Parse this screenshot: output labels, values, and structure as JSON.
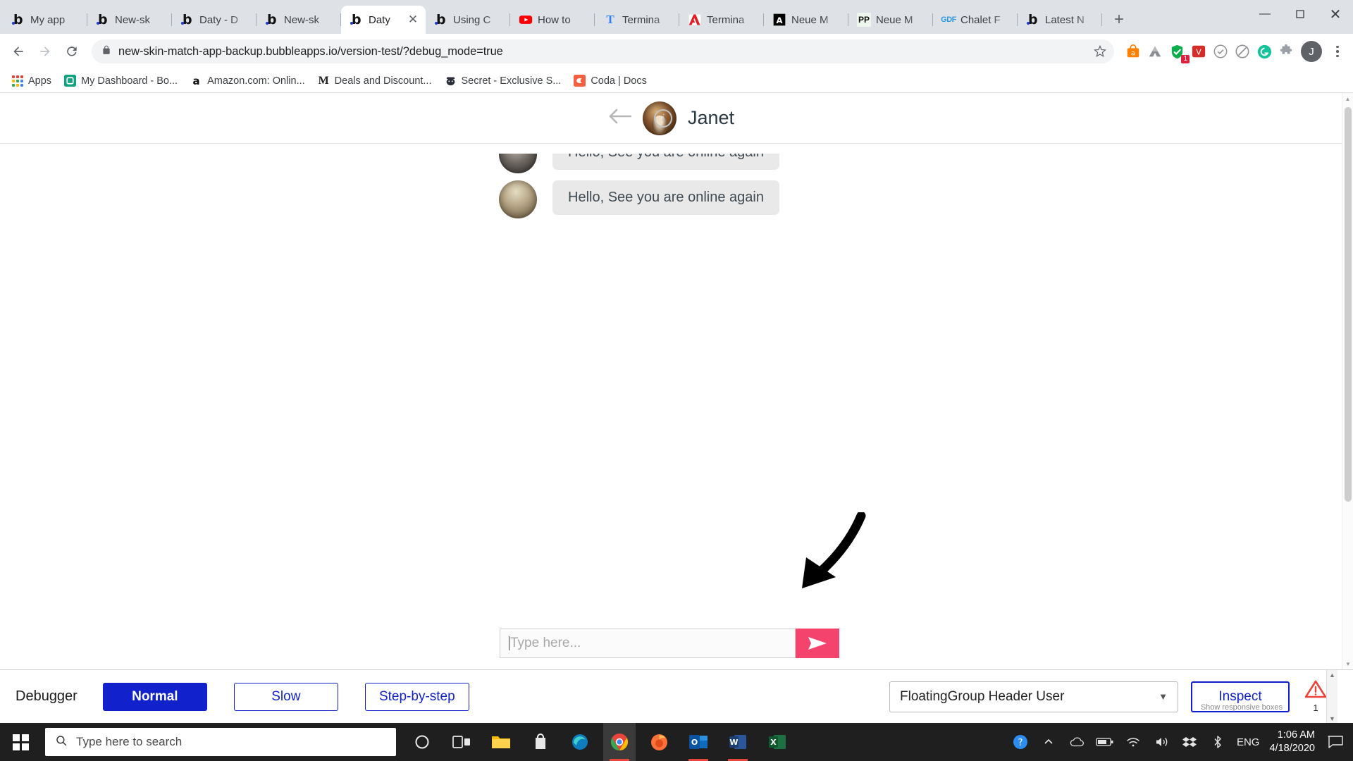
{
  "browser": {
    "tabs": [
      {
        "title": "My app",
        "icon": "bubble-icon",
        "active": false
      },
      {
        "title": "New-sk",
        "icon": "bubble-icon",
        "active": false
      },
      {
        "title": "Daty - D",
        "icon": "bubble-icon",
        "active": false
      },
      {
        "title": "New-sk",
        "icon": "bubble-icon",
        "active": false
      },
      {
        "title": "Daty",
        "icon": "bubble-icon",
        "active": true
      },
      {
        "title": "Using C",
        "icon": "bubble-icon",
        "active": false
      },
      {
        "title": "How to",
        "icon": "youtube-icon",
        "active": false
      },
      {
        "title": "Termina",
        "icon": "t-icon",
        "active": false
      },
      {
        "title": "Termina",
        "icon": "adobe-icon",
        "active": false
      },
      {
        "title": "Neue M",
        "icon": "a-icon",
        "active": false
      },
      {
        "title": "Neue M",
        "icon": "pp-icon",
        "active": false
      },
      {
        "title": "Chalet F",
        "icon": "gdf-icon",
        "active": false
      },
      {
        "title": "Latest N",
        "icon": "bubble-icon",
        "active": false
      }
    ],
    "new_tab_label": "+",
    "window_controls": {
      "minimize": "—",
      "maximize": "☐",
      "close": "✕"
    },
    "nav": {
      "back": "←",
      "forward": "→",
      "reload": "⟳"
    },
    "omnibox": {
      "url": "new-skin-match-app-backup.bubbleapps.io/version-test/?debug_mode=true",
      "lock_icon": "lock-icon",
      "star_icon": "star-icon"
    },
    "extensions": [
      {
        "name": "honey-icon",
        "badge": ""
      },
      {
        "name": "drive-icon",
        "badge": ""
      },
      {
        "name": "shield-check-icon",
        "badge": "1"
      },
      {
        "name": "lastpass-icon",
        "badge": ""
      },
      {
        "name": "check-circle-icon",
        "badge": ""
      },
      {
        "name": "adblock-icon",
        "badge": ""
      },
      {
        "name": "grammarly-icon",
        "badge": ""
      },
      {
        "name": "puzzle-icon",
        "badge": ""
      }
    ],
    "profile_initial": "J",
    "menu_icon": "kebab-menu-icon",
    "bookmarks": [
      {
        "label": "Apps",
        "icon": "apps-grid-icon"
      },
      {
        "label": "My Dashboard - Bo...",
        "icon": "bubble-square-icon"
      },
      {
        "label": "Amazon.com: Onlin...",
        "icon": "amazon-icon"
      },
      {
        "label": "Deals and Discount...",
        "icon": "m-icon"
      },
      {
        "label": "Secret - Exclusive S...",
        "icon": "detective-icon"
      },
      {
        "label": "Coda | Docs",
        "icon": "coda-icon"
      }
    ]
  },
  "app": {
    "header": {
      "back_icon": "back-arrow-icon",
      "avatar": "janet-avatar",
      "name": "Janet",
      "info_icon": "info-icon"
    },
    "messages": [
      {
        "avatar": "contact-avatar-a",
        "text": "Hello, See you are online again",
        "clipped": true
      },
      {
        "avatar": "contact-avatar-b",
        "text": "Hello, See you are online again",
        "clipped": false
      }
    ],
    "annotation": {
      "type": "arrow",
      "color": "#000000"
    },
    "composer": {
      "placeholder": "Type here...",
      "value": "",
      "send_icon": "send-icon",
      "send_color": "#f4436c"
    },
    "bottom_nav": [
      {
        "name": "profile-icon",
        "active": false
      },
      {
        "name": "heart-icon",
        "active": false
      },
      {
        "name": "star-icon",
        "active": false
      },
      {
        "name": "chat-icon",
        "active": true
      }
    ],
    "accent_color": "#f4436c"
  },
  "debugger": {
    "label": "Debugger",
    "buttons": [
      {
        "label": "Normal",
        "style": "primary"
      },
      {
        "label": "Slow",
        "style": "outline"
      },
      {
        "label": "Step-by-step",
        "style": "outline"
      }
    ],
    "element_select": {
      "value": "FloatingGroup Header User",
      "chevron": "chevron-down-icon"
    },
    "inspect_label": "Inspect",
    "responsive_note": "Show responsive boxes",
    "warning": {
      "icon": "warning-triangle-icon",
      "count": "1",
      "color": "#e8453c"
    }
  },
  "taskbar": {
    "start_icon": "windows-start-icon",
    "search_placeholder": "Type here to search",
    "search_icon": "search-icon",
    "items": [
      {
        "name": "cortana-icon"
      },
      {
        "name": "task-view-icon"
      },
      {
        "name": "file-explorer-icon"
      },
      {
        "name": "microsoft-store-icon"
      },
      {
        "name": "edge-icon"
      },
      {
        "name": "chrome-icon",
        "active": true
      },
      {
        "name": "firefox-icon"
      },
      {
        "name": "outlook-icon",
        "active": true
      },
      {
        "name": "word-icon",
        "active": true
      },
      {
        "name": "excel-icon"
      }
    ],
    "tray": [
      {
        "name": "help-circle-icon"
      },
      {
        "name": "show-hidden-icons-icon"
      },
      {
        "name": "onedrive-icon"
      },
      {
        "name": "battery-icon"
      },
      {
        "name": "wifi-icon"
      },
      {
        "name": "volume-icon"
      },
      {
        "name": "dropbox-icon"
      },
      {
        "name": "bluetooth-icon"
      }
    ],
    "language": "ENG",
    "time": "1:06 AM",
    "date": "4/18/2020",
    "notification_icon": "notification-icon"
  }
}
